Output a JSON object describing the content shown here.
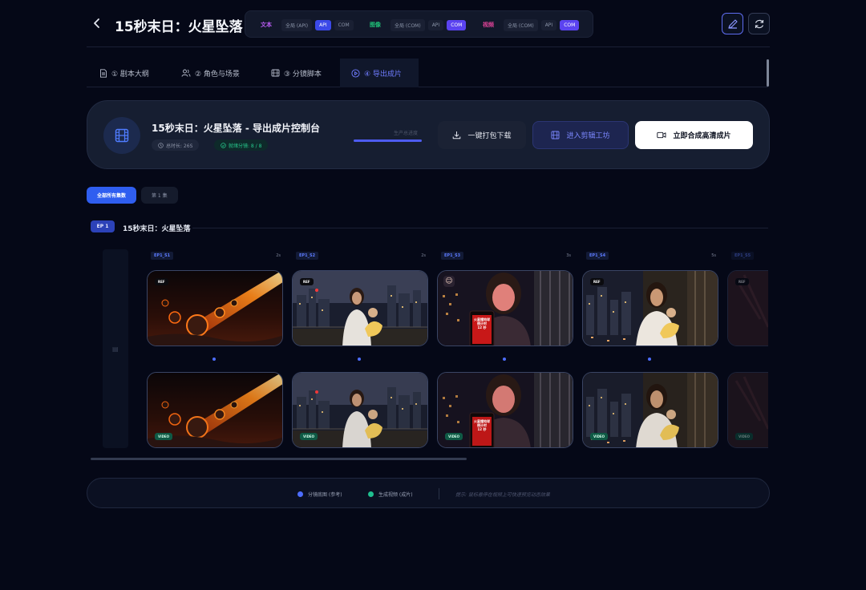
{
  "header": {
    "title": "15秒末日：火星坠落",
    "modes": [
      {
        "label": "文本",
        "color": "#b85cf2",
        "options": [
          "全局 (API)",
          "API",
          "COM"
        ],
        "active": 1
      },
      {
        "label": "图像",
        "color": "#1fbf77",
        "options": [
          "全局 (COM)",
          "API",
          "COM"
        ],
        "active": 2
      },
      {
        "label": "视频",
        "color": "#e2449a",
        "options": [
          "全局 (COM)",
          "API",
          "COM"
        ],
        "active": 2
      }
    ]
  },
  "tabs": [
    "① 剧本大纲",
    "② 角色与场景",
    "③ 分镜脚本",
    "④ 导出成片"
  ],
  "console": {
    "title": "15秒末日：火星坠落 - 导出成片控制台",
    "duration_label": "总时长: 26S",
    "ready_label": "就绪分镜: 8 / 8",
    "progress_label": "生产总进度",
    "progress": 1.0,
    "download_label": "一键打包下载",
    "edit_label": "进入剪辑工坊",
    "compose_label": "立即合成高清成片"
  },
  "filters": [
    "全部所有集数",
    "第 1 集"
  ],
  "episode": {
    "badge": "EP 1",
    "title": "15秒末日：火星坠落"
  },
  "shots": [
    {
      "id": "EP1_S1",
      "duration": "2s",
      "scene": "meteor",
      "ref": "REF",
      "video": "VIDEO"
    },
    {
      "id": "EP1_S2",
      "duration": "2s",
      "scene": "balcony-calm",
      "ref": "REF",
      "video": "VIDEO"
    },
    {
      "id": "EP1_S3",
      "duration": "3s",
      "scene": "phone-alert",
      "ref": "",
      "video": "VIDEO",
      "phone_text": "火星撞地球\n倒计时\n12 秒"
    },
    {
      "id": "EP1_S4",
      "duration": "5s",
      "scene": "balcony-scared",
      "ref": "REF",
      "video": "VIDEO"
    },
    {
      "id": "EP1_S5",
      "duration": "",
      "scene": "dark",
      "ref": "REF",
      "video": "VIDEO"
    }
  ],
  "legend": {
    "ref_label": "分镜底图 (参考)",
    "video_label": "生成视频 (成片)",
    "hint": "提示: 鼠标悬停在视频上可快速预览动态效果",
    "ref_color": "#4d6dff",
    "video_color": "#1fbf8f"
  }
}
